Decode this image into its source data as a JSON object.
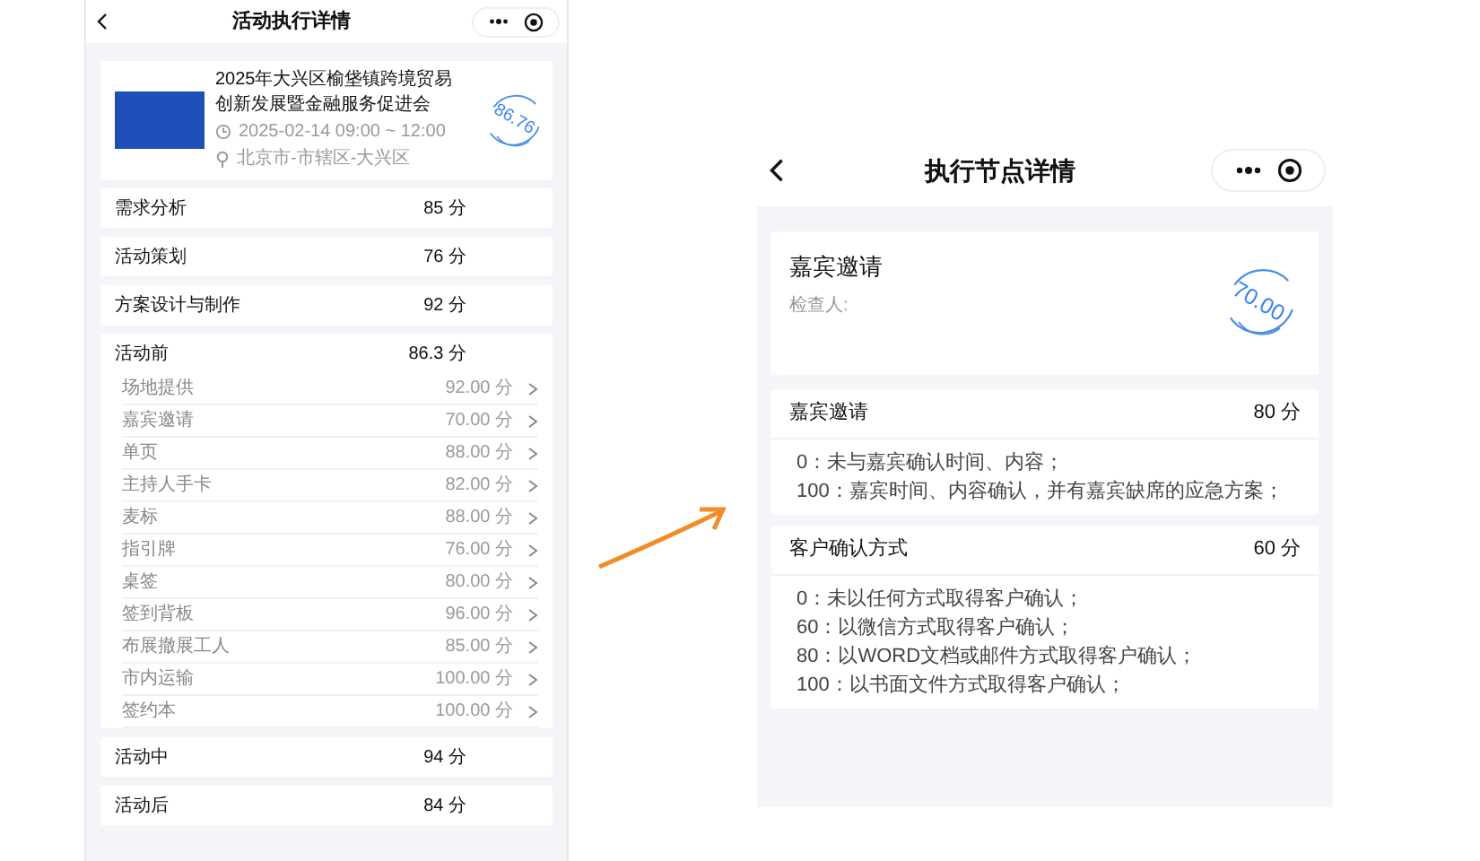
{
  "left": {
    "nav_title": "活动执行详情",
    "event": {
      "title": "2025年大兴区榆垡镇跨境贸易创新发展暨金融服务促进会",
      "time": "2025-02-14 09:00 ~ 12:00",
      "location": "北京市-市辖区-大兴区",
      "score_stamp": "86.76"
    },
    "sections": [
      {
        "name": "需求分析",
        "score": "85 分"
      },
      {
        "name": "活动策划",
        "score": "76 分"
      },
      {
        "name": "方案设计与制作",
        "score": "92 分"
      },
      {
        "name": "活动前",
        "score": "86.3 分",
        "expanded": true,
        "items": [
          {
            "name": "场地提供",
            "score": "92.00 分"
          },
          {
            "name": "嘉宾邀请",
            "score": "70.00 分"
          },
          {
            "name": "单页",
            "score": "88.00 分"
          },
          {
            "name": "主持人手卡",
            "score": "82.00 分"
          },
          {
            "name": "麦标",
            "score": "88.00 分"
          },
          {
            "name": "指引牌",
            "score": "76.00 分"
          },
          {
            "name": "桌签",
            "score": "80.00 分"
          },
          {
            "name": "签到背板",
            "score": "96.00 分"
          },
          {
            "name": "布展撤展工人",
            "score": "85.00 分"
          },
          {
            "name": "市内运输",
            "score": "100.00 分"
          },
          {
            "name": "签约本",
            "score": "100.00 分"
          }
        ]
      },
      {
        "name": "活动中",
        "score": "94 分"
      },
      {
        "name": "活动后",
        "score": "84 分"
      }
    ]
  },
  "right": {
    "nav_title": "执行节点详情",
    "node": {
      "title": "嘉宾邀请",
      "inspector_label": "检查人:",
      "score_stamp": "70.00"
    },
    "criteria": [
      {
        "name": "嘉宾邀请",
        "score": "80 分",
        "rules": [
          "0：未与嘉宾确认时间、内容；",
          "100：嘉宾时间、内容确认，并有嘉宾缺席的应急方案；"
        ]
      },
      {
        "name": "客户确认方式",
        "score": "60 分",
        "rules": [
          "0：未以任何方式取得客户确认；",
          "60：以微信方式取得客户确认；",
          "80：以WORD文档或邮件方式取得客户确认；",
          "100：以书面文件方式取得客户确认；"
        ]
      }
    ]
  }
}
